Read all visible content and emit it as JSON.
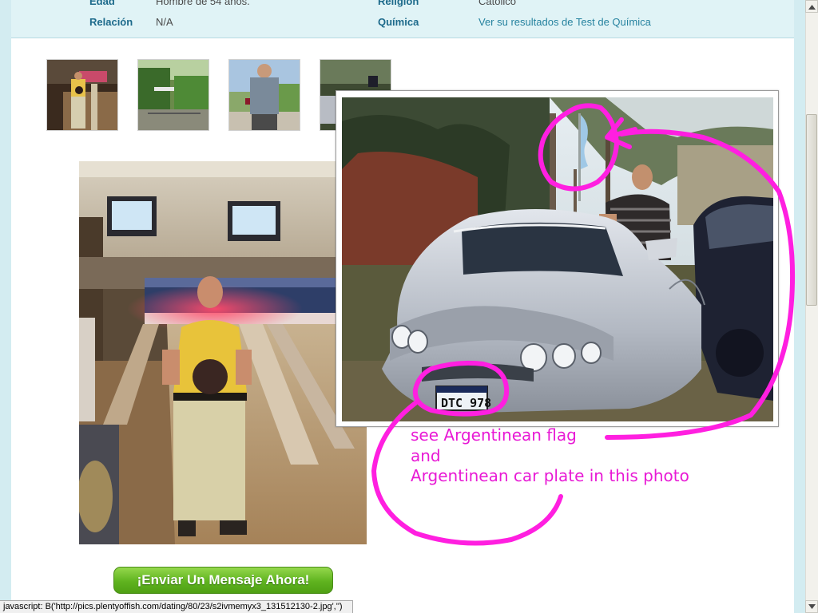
{
  "profile": {
    "rows": [
      {
        "label": "Edad",
        "value": "Hombre de 54 años.",
        "label2": "Religión",
        "value2": "Católico"
      },
      {
        "label": "Relación",
        "value": "N/A",
        "label2": "Química",
        "value2": "Ver su resultados de Test de Química"
      }
    ]
  },
  "thumbnails": [
    "bowling-alley-photo",
    "garden-photo",
    "wine-glass-photo",
    "car-photo"
  ],
  "annotation": {
    "lines": [
      "see Argentinean flag",
      "and",
      "Argentinean car plate in this photo"
    ],
    "color": "#e81ad5"
  },
  "car_plate": "DTC 978",
  "send_button": {
    "label": "¡Enviar Un Mensaje Ahora!"
  },
  "status_bar": {
    "text": "javascript: B('http://pics.plentyoffish.com/dating/80/23/s2ivmemyx3_131512130-2.jpg','')"
  },
  "colors": {
    "label": "#1d6a8b",
    "link": "#25829f",
    "button": "#5fb31f",
    "ink": "#e81ad5"
  }
}
